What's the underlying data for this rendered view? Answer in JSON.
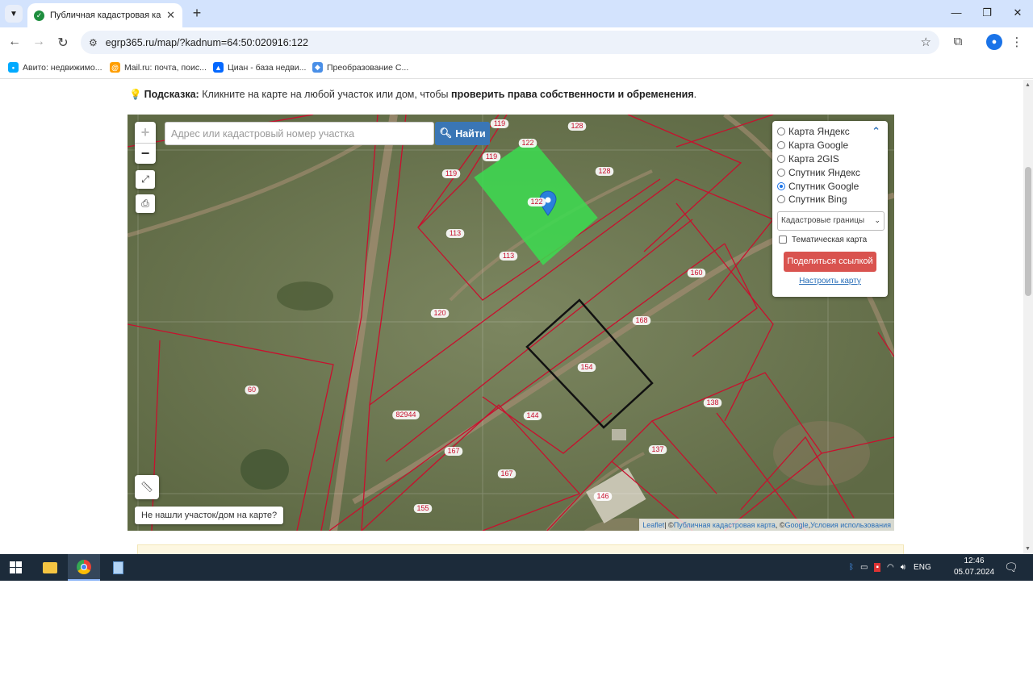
{
  "browser": {
    "tab_title": "Публичная кадастровая карта",
    "url": "egrp365.ru/map/?kadnum=64:50:020916:122",
    "bookmarks": [
      "Авито: недвижимо...",
      "Mail.ru: почта, поис...",
      "Циан - база недви...",
      "Преобразование С..."
    ]
  },
  "hint": {
    "label": "Подсказка:",
    "text": "Кликните на карте на любой участок или дом, чтобы",
    "bold": "проверить права собственности и обременения",
    "end": "."
  },
  "map": {
    "search_placeholder": "Адрес или кадастровый номер участка",
    "search_button": "Найти",
    "zoom_in": "+",
    "zoom_out": "−",
    "layers": [
      {
        "label": "Карта Яндекс",
        "selected": false
      },
      {
        "label": "Карта Google",
        "selected": false
      },
      {
        "label": "Карта 2GIS",
        "selected": false
      },
      {
        "label": "Спутник Яндекс",
        "selected": false
      },
      {
        "label": "Спутник Google",
        "selected": true
      },
      {
        "label": "Спутник Bing",
        "selected": false
      }
    ],
    "overlay_select": "Кадастровые границы",
    "thematic_label": "Тематическая карта",
    "share_button": "Поделиться ссылкой",
    "configure_link": "Настроить карту",
    "not_found": "Не нашли участок/дом на карте?",
    "attribution": {
      "leaflet": "Leaflet",
      "pkk": "Публичная кадастровая карта",
      "google": "Google",
      "terms": "Условия использования",
      "sep1": " | © ",
      "sep2": ", © ",
      "sep3": ", "
    },
    "parcel_labels": [
      "119",
      "128",
      "119",
      "122",
      "119",
      "128",
      "122",
      "113",
      "113",
      "160",
      "120",
      "168",
      "154",
      "60",
      "82944",
      "144",
      "138",
      "167",
      "137",
      "167",
      "146",
      "155"
    ]
  },
  "taskbar": {
    "lang": "ENG",
    "time": "12:46",
    "date": "05.07.2024"
  },
  "colors": {
    "parcel_border": "#c8102e",
    "selected_parcel": "#3cdc50",
    "search_button": "#3a76b5",
    "share_button": "#d9534f",
    "taskbar": "#1c2b3a"
  }
}
